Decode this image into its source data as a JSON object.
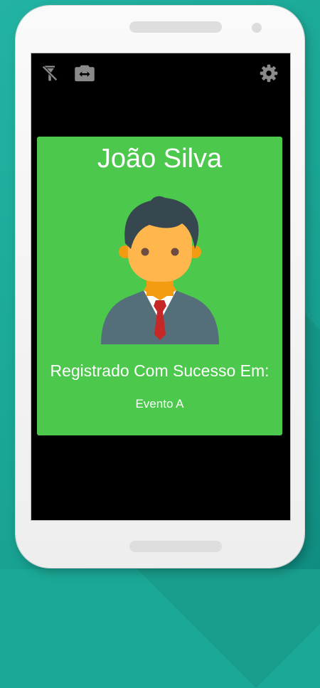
{
  "icons": {
    "flash": "flash-off-icon",
    "camera_switch": "switch-camera-icon",
    "settings": "gear-icon",
    "avatar": "businessman-avatar-icon"
  },
  "colors": {
    "card_background": "#4cc94c",
    "frame_background": "#1ba896",
    "screen_background": "#000000",
    "text": "#ffffff"
  },
  "card": {
    "name": "João Silva",
    "status": "Registrado Com Sucesso Em:",
    "event": "Evento A"
  }
}
